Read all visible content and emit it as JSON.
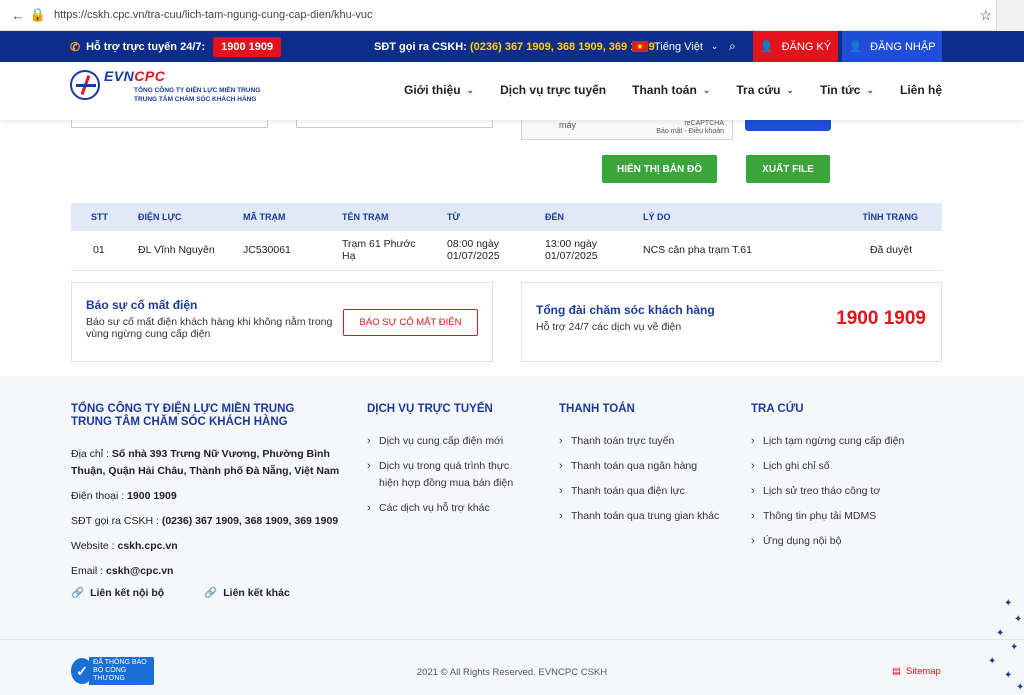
{
  "browser": {
    "url": "https://cskh.cpc.vn/tra-cuu/lich-tam-ngung-cung-cap-dien/khu-vuc"
  },
  "topbar": {
    "hotline_label": "Hỗ trợ trực tuyến 24/7:",
    "hotline_number": "1900 1909",
    "cskh_label": "SĐT gọi ra CSKH:",
    "cskh_numbers": "(0236) 367 1909, 368 1909, 369 1909",
    "language": "Tiếng Việt",
    "register": "ĐĂNG KÝ",
    "login": "ĐĂNG NHẬP"
  },
  "logo": {
    "brand_a": "EVN",
    "brand_b": "CPC",
    "line1": "TỔNG CÔNG TY ĐIỆN LỰC MIỀN TRUNG",
    "line2": "TRUNG TÂM CHĂM SÓC KHÁCH HÀNG"
  },
  "nav": [
    {
      "label": "Giới thiệu",
      "dropdown": true
    },
    {
      "label": "Dịch vụ trực tuyến",
      "dropdown": false
    },
    {
      "label": "Thanh toán",
      "dropdown": true
    },
    {
      "label": "Tra cứu",
      "dropdown": true
    },
    {
      "label": "Tin tức",
      "dropdown": true
    },
    {
      "label": "Liên hệ",
      "dropdown": false
    }
  ],
  "captcha": {
    "partial_text": "máy",
    "brand": "reCAPTCHA",
    "terms": "Bảo mật - Điều khoản"
  },
  "actions": {
    "map_button": "HIỂN THỊ BẢN ĐỒ",
    "export_button": "XUẤT FILE"
  },
  "table": {
    "headers": [
      "STT",
      "ĐIỆN LỰC",
      "MÃ TRẠM",
      "TÊN TRẠM",
      "TỪ",
      "ĐẾN",
      "LÝ DO",
      "TÌNH TRẠNG"
    ],
    "rows": [
      {
        "stt": "01",
        "dien_luc": "ĐL Vĩnh Nguyên",
        "ma_tram": "JC530061",
        "ten_tram": "Trạm 61 Phước Hạ",
        "tu": "08:00 ngày 01/07/2025",
        "den": "13:00 ngày 01/07/2025",
        "ly_do": "NCS cân pha trạm T.61",
        "tinh_trang": "Đã duyệt"
      }
    ]
  },
  "report_box": {
    "title": "Báo sự cố mất điện",
    "desc": "Báo sự cố mất điện khách hàng khi không nằm trong vùng ngừng cung cấp điện",
    "button": "BÁO SỰ CỐ MẤT ĐIỆN"
  },
  "support_box": {
    "title": "Tổng đài chăm sóc khách hàng",
    "desc": "Hỗ trợ 24/7 các dịch vụ về điện",
    "number": "1900 1909"
  },
  "footer": {
    "company_line1": "TỔNG CÔNG TY ĐIỆN LỰC MIỀN TRUNG",
    "company_line2": "TRUNG TÂM CHĂM SÓC KHÁCH HÀNG",
    "address_label": "Địa chỉ :",
    "address": "Số nhà 393 Trưng Nữ Vương, Phường Bình Thuận, Quận Hải Châu, Thành phố Đà Nẵng, Việt Nam",
    "phone_label": "Điện thoại :",
    "phone": "1900 1909",
    "cskh_label": "SĐT gọi ra CSKH :",
    "cskh": "(0236) 367 1909, 368 1909, 369 1909",
    "website_label": "Website :",
    "website": "cskh.cpc.vn",
    "email_label": "Email :",
    "email": "cskh@cpc.vn",
    "internal_link": "Liên kết nội bộ",
    "other_link": "Liên kết khác",
    "col_online": {
      "title": "DỊCH VỤ TRỰC TUYẾN",
      "items": [
        "Dịch vụ cung cấp điện mới",
        "Dịch vụ trong quá trình thực hiện hợp đồng mua bán điện",
        "Các dịch vụ hỗ trợ khác"
      ]
    },
    "col_payment": {
      "title": "THANH TOÁN",
      "items": [
        "Thanh toán trực tuyến",
        "Thanh toán qua ngân hàng",
        "Thanh toán qua điện lực",
        "Thanh toán qua trung gian khác"
      ]
    },
    "col_lookup": {
      "title": "TRA CỨU",
      "items": [
        "Lịch tạm ngừng cung cấp điện",
        "Lịch ghi chỉ số",
        "Lịch sử treo tháo công tơ",
        "Thông tin phụ tải MDMS",
        "Ứng dụng nội bộ"
      ]
    },
    "badge_line1": "ĐÃ THÔNG BÁO",
    "badge_line2": "BỘ CÔNG THƯƠNG",
    "copyright": "2021 © All Rights Reserved. EVNCPC CSKH",
    "sitemap": "Sitemap"
  }
}
